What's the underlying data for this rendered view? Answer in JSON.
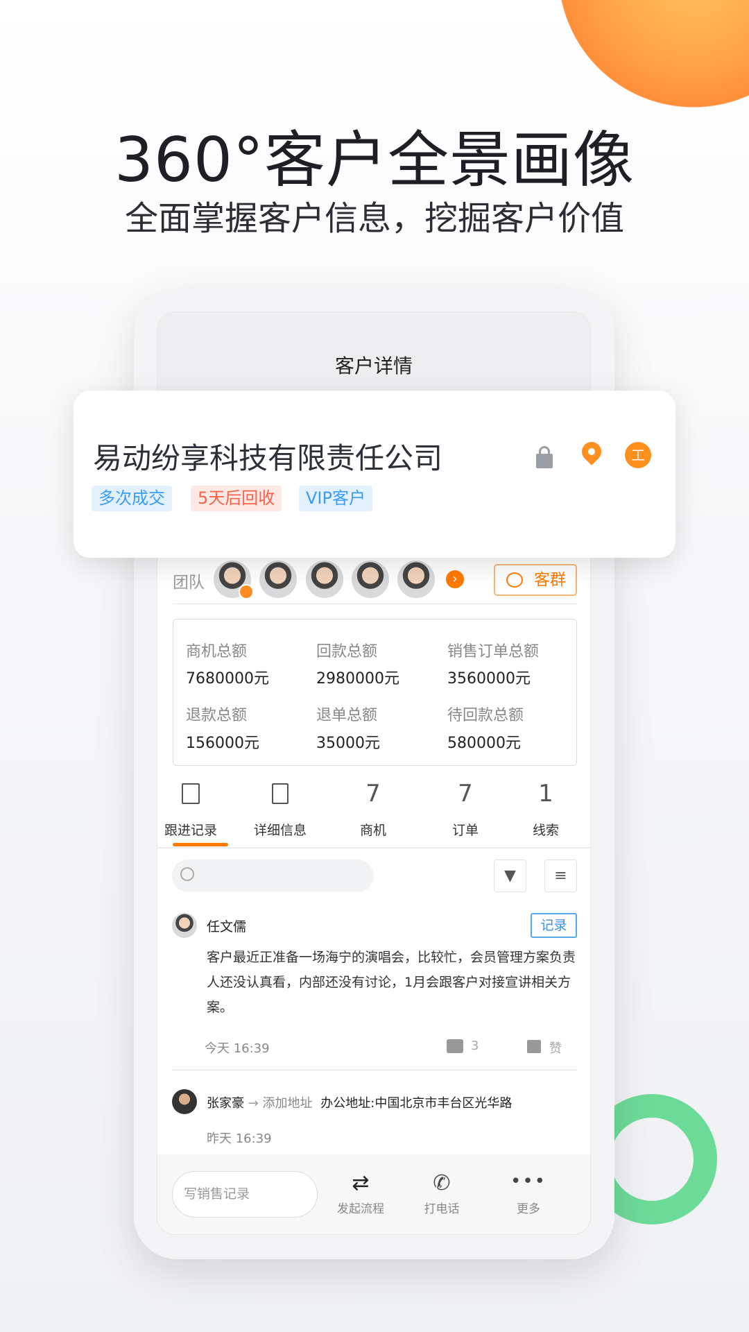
{
  "headline": {
    "title": "360°客户全景画像",
    "subtitle": "全面掌握客户信息，挖掘客户价值"
  },
  "screen": {
    "title": "客户详情"
  },
  "customer": {
    "name": "易动纷享科技有限责任公司",
    "tags": [
      {
        "label": "多次成交",
        "color": "#3a9cf5",
        "bg": "#e3f1ff"
      },
      {
        "label": "5天后回收",
        "color": "#f5634a",
        "bg": "#ffe9e5"
      },
      {
        "label": "VIP客户",
        "color": "#3a9cf5",
        "bg": "#e3f1ff"
      }
    ],
    "icons": [
      "lock-icon",
      "location-pin-icon",
      "business-icon"
    ],
    "business_icon_text": "工"
  },
  "team": {
    "label": "团队",
    "group_button": "客群",
    "accent": "#ff8a1f"
  },
  "stats": [
    {
      "label": "商机总额",
      "value": "7680000元"
    },
    {
      "label": "回款总额",
      "value": "2980000元"
    },
    {
      "label": "销售订单总额",
      "value": "3560000元"
    },
    {
      "label": "退款总额",
      "value": "156000元"
    },
    {
      "label": "退单总额",
      "value": "35000元"
    },
    {
      "label": "待回款总额",
      "value": "580000元"
    }
  ],
  "tabs": [
    {
      "label": "跟进记录",
      "icon": "record-clock-icon",
      "active": true
    },
    {
      "label": "详细信息",
      "icon": "list-icon"
    },
    {
      "label": "商机",
      "count": "7"
    },
    {
      "label": "订单",
      "count": "7"
    },
    {
      "label": "线索",
      "count": "1"
    }
  ],
  "feed": [
    {
      "author": "任文儒",
      "badge": "记录",
      "text": "客户最近正准备一场海宁的演唱会，比较忙，会员管理方案负责人还没认真看，内部还没有讨论，1月会跟客户对接宣讲相关方案。",
      "time": "今天 16:39",
      "comments": "3",
      "like": "赞"
    },
    {
      "author": "张家豪",
      "action": "添加地址",
      "detail": "办公地址:中国北京市丰台区光华路",
      "time": "昨天 16:39"
    }
  ],
  "bottom": {
    "input_placeholder": "写销售记录",
    "actions": [
      {
        "label": "发起流程",
        "icon": "transfer-icon"
      },
      {
        "label": "打电话",
        "icon": "phone-icon"
      },
      {
        "label": "更多",
        "icon": "more-icon"
      }
    ]
  }
}
